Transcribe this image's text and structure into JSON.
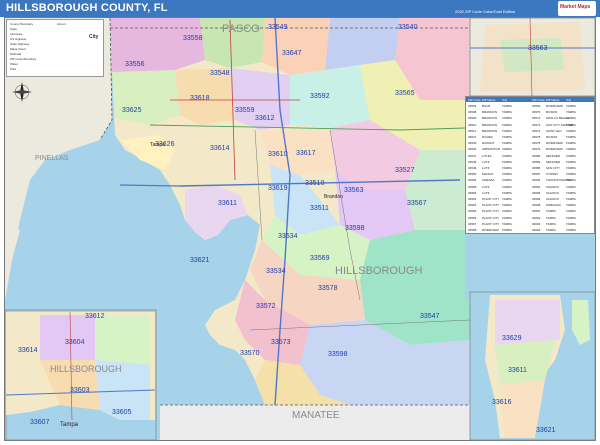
{
  "header": {
    "title": "HILLSBOROUGH COUNTY, FL",
    "edition": "2022 ZIP Code Color/Cast Edition",
    "logo_text": "Market Maps"
  },
  "map": {
    "county_labels": [
      "PASCO",
      "PINELLAS",
      "HILLSBOROUGH",
      "MANATEE"
    ],
    "places": [
      "Tampa",
      "Brandon"
    ],
    "zip_labels": [
      "33556",
      "33558",
      "33548",
      "33549",
      "33544",
      "33647",
      "33540",
      "33625",
      "33592",
      "33559",
      "33565",
      "33626",
      "33618",
      "33612",
      "33617",
      "33614",
      "33610",
      "33619",
      "33510",
      "33563",
      "33567",
      "33527",
      "33511",
      "33629",
      "33611",
      "33611",
      "33569",
      "33616",
      "33621",
      "33534",
      "33578",
      "33572",
      "33547",
      "33573",
      "33598",
      "33594",
      "33570"
    ],
    "colors": {
      "water": "#9ccde6",
      "land": "#e8e6dc",
      "accent": "#3c78c0"
    }
  },
  "legend": {
    "rows": [
      "County Boundary",
      "State",
      "Interstate",
      "US Highway",
      "State Highway",
      "Major Road",
      "Railroad",
      "ZIP Code Boundary",
      "Water",
      "Park",
      "Airport",
      "City"
    ]
  },
  "insets": {
    "top_right_zip": "33563",
    "bottom_left_zips": [
      "33612",
      "33614",
      "33604",
      "33603",
      "33607",
      "33605"
    ],
    "bottom_left_place": "Tampa",
    "bottom_left_county": "HILLSBOROUGH",
    "bottom_right_zips": [
      "33629",
      "33611",
      "33616",
      "33621"
    ]
  },
  "zip_table": {
    "headers": [
      "ZIP Code",
      "ZIP Name",
      "City"
    ],
    "rows": [
      [
        "33503",
        "BALM",
        "TAMPA"
      ],
      [
        "33508",
        "BRANDON",
        "TAMPA"
      ],
      [
        "33509",
        "BRANDON",
        "TAMPA"
      ],
      [
        "33510",
        "BRANDON",
        "TAMPA"
      ],
      [
        "33511",
        "BRANDON",
        "TAMPA"
      ],
      [
        "33527",
        "DOVER",
        "TAMPA"
      ],
      [
        "33530",
        "DURANT",
        "TAMPA"
      ],
      [
        "33534",
        "GIBSONTON",
        "TAMPA"
      ],
      [
        "33547",
        "LITHIA",
        "TAMPA"
      ],
      [
        "33548",
        "LUTZ",
        "TAMPA"
      ],
      [
        "33549",
        "LUTZ",
        "TAMPA"
      ],
      [
        "33550",
        "MANGO",
        "TAMPA"
      ],
      [
        "33556",
        "ODESSA",
        "TAMPA"
      ],
      [
        "33558",
        "LUTZ",
        "TAMPA"
      ],
      [
        "33559",
        "LUTZ",
        "TAMPA"
      ],
      [
        "33563",
        "PLANT CITY",
        "TAMPA"
      ],
      [
        "33564",
        "PLANT CITY",
        "TAMPA"
      ],
      [
        "33565",
        "PLANT CITY",
        "TAMPA"
      ],
      [
        "33566",
        "PLANT CITY",
        "TAMPA"
      ],
      [
        "33567",
        "PLANT CITY",
        "TAMPA"
      ],
      [
        "33568",
        "RIVERVIEW",
        "TAMPA"
      ],
      [
        "33569",
        "RIVERVIEW",
        "TAMPA"
      ],
      [
        "33570",
        "RUSKIN",
        "TAMPA"
      ],
      [
        "33572",
        "APOLLO BEACH",
        "TAMPA"
      ],
      [
        "33573",
        "SUN CITY CENTER",
        "TAMPA"
      ],
      [
        "33574",
        "SAINT LEO",
        "TAMPA"
      ],
      [
        "33575",
        "RUSKIN",
        "TAMPA"
      ],
      [
        "33578",
        "RIVERVIEW",
        "TAMPA"
      ],
      [
        "33579",
        "RIVERVIEW",
        "TAMPA"
      ],
      [
        "33583",
        "SEFFNER",
        "TAMPA"
      ],
      [
        "33584",
        "SEFFNER",
        "TAMPA"
      ],
      [
        "33586",
        "SUN CITY",
        "TAMPA"
      ],
      [
        "33587",
        "SYDNEY",
        "TAMPA"
      ],
      [
        "33592",
        "THONOTOSASSA",
        "TAMPA"
      ],
      [
        "33594",
        "VALRICO",
        "TAMPA"
      ],
      [
        "33595",
        "VALRICO",
        "TAMPA"
      ],
      [
        "33596",
        "VALRICO",
        "TAMPA"
      ],
      [
        "33598",
        "WIMAUMA",
        "TAMPA"
      ],
      [
        "33601",
        "TAMPA",
        "TAMPA"
      ],
      [
        "33602",
        "TAMPA",
        "TAMPA"
      ],
      [
        "33603",
        "TAMPA",
        "TAMPA"
      ],
      [
        "33604",
        "TAMPA",
        "TAMPA"
      ]
    ]
  }
}
